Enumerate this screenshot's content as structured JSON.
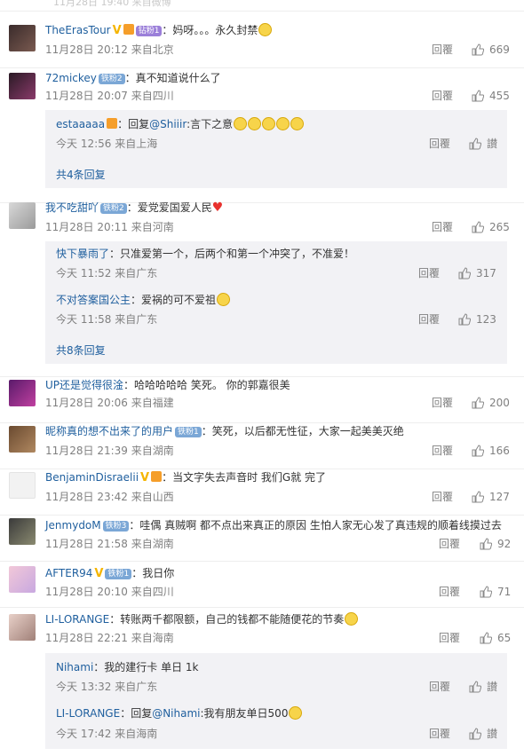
{
  "top_partial": "11月28日 19:40 来自微博",
  "comments": [
    {
      "name": "TheErasTour",
      "badge": "钻粉1",
      "text": "：妈呀。。。永久封禁",
      "meta": "11月28日 20:12 来自北京",
      "reply": "回覆",
      "likes": "669"
    },
    {
      "name": "72mickey",
      "badge": "铁粉2",
      "text": "：真不知道说什么了",
      "meta": "11月28日 20:07 来自四川",
      "reply": "回覆",
      "likes": "455",
      "subs": [
        {
          "name": "estaaaaa",
          "text": "：回复",
          "mention": "@Shiiir",
          "text2": ":言下之意",
          "meta": "今天 12:56 来自上海",
          "reply": "回覆",
          "likes": "讃"
        }
      ],
      "more": "共4条回复"
    },
    {
      "name": "我不吃甜吖",
      "badge": "铁粉2",
      "text": "：爱党爱国爱人民",
      "meta": "11月28日 20:11 来自河南",
      "reply": "回覆",
      "likes": "265",
      "subs": [
        {
          "name": "快下暴雨了",
          "text": "：只准爱第一个，后两个和第一个冲突了，不准爱！",
          "meta": "今天 11:52 来自广东",
          "reply": "回覆",
          "likes": "317"
        },
        {
          "name": "不对答案国公主",
          "text": "：爱祸的可不爱祖",
          "meta": "今天 11:58 来自广东",
          "reply": "回覆",
          "likes": "123"
        }
      ],
      "more": "共8条回复"
    },
    {
      "name": "UP还是觉得很淦",
      "text": "：哈哈哈哈哈 笑死。 你的郭嘉很美",
      "meta": "11月28日 20:06 来自福建",
      "reply": "回覆",
      "likes": "200"
    },
    {
      "name": "昵称真的想不出来了的用户",
      "badge": "铁粉1",
      "text": "：笑死，以后都无性征，大家一起美美灭绝",
      "meta": "11月28日 21:39 来自湖南",
      "reply": "回覆",
      "likes": "166"
    },
    {
      "name": "BenjaminDisraelii",
      "text": "：当文字失去声音时 我们G就 完了",
      "meta": "11月28日 23:42 来自山西",
      "reply": "回覆",
      "likes": "127"
    },
    {
      "name": "JenmydoM",
      "badge": "铁粉3",
      "text": "：哇偶 真贼啊 都不点出来真正的原因 生怕人家无心发了真违规的顺着线摸过去",
      "meta": "11月28日 21:58 来自湖南",
      "reply": "回覆",
      "likes": "92"
    },
    {
      "name": "AFTER94",
      "badge": "铁粉1",
      "text": "：我日你",
      "meta": "11月28日 20:10 来自四川",
      "reply": "回覆",
      "likes": "71"
    },
    {
      "name": "LI-LORANGE",
      "text": "：转账两千都限额，自己的钱都不能随便花的节奏",
      "meta": "11月28日 22:21 来自海南",
      "reply": "回覆",
      "likes": "65",
      "subs": [
        {
          "name": "Nihami",
          "text": "：我的建行卡 单日 1k",
          "meta": "今天 13:32 来自广东",
          "reply": "回覆",
          "likes": "讃"
        },
        {
          "name": "LI-LORANGE",
          "text": "：回复",
          "mention": "@Nihami",
          "text2": ":我有朋友单日500",
          "meta": "今天 17:42 来自海南",
          "reply": "回覆",
          "likes": "讃"
        }
      ]
    }
  ],
  "colors": {
    "link": "#1f5f9e",
    "meta": "#808080",
    "reply_bg": "#f2f2f5"
  }
}
